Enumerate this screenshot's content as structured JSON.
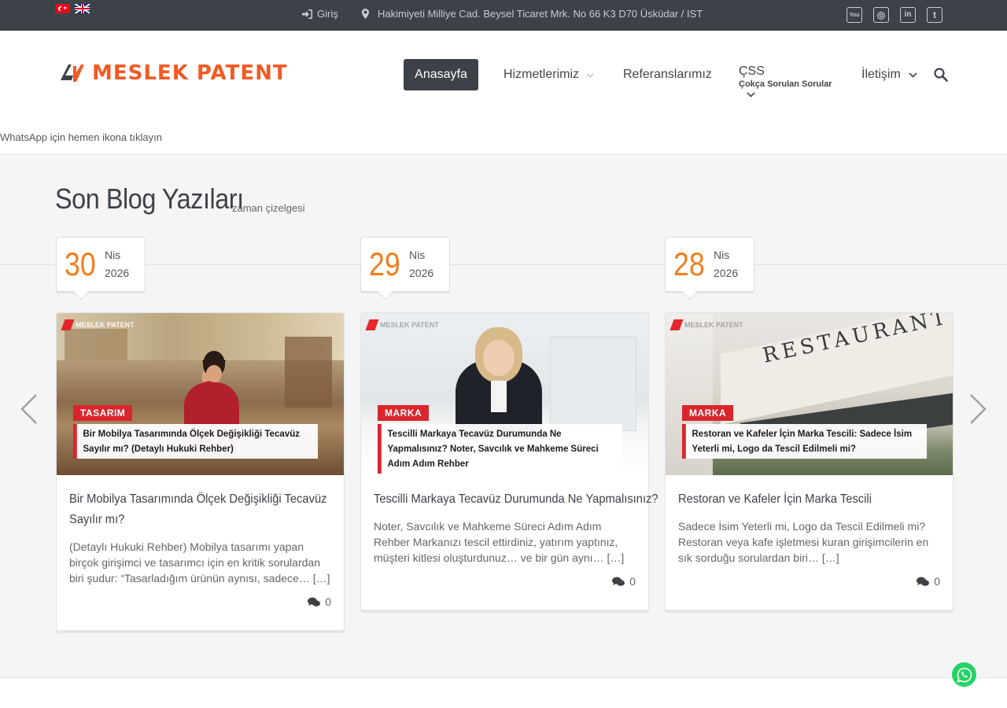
{
  "topbar": {
    "login_label": "Giriş",
    "address": "Hakimiyeti Milliye Cad. Beysel Ticaret Mrk. No 66 K3 D70 Üsküdar / IST",
    "flags": [
      "tr-flag-icon",
      "en-flag-icon"
    ],
    "social_icons": [
      "youtube-icon",
      "instagram-icon",
      "linkedin-icon",
      "twitter-icon"
    ],
    "social_glyphs": {
      "youtube": "You",
      "instagram": "◎",
      "linkedin": "in",
      "twitter": "t"
    }
  },
  "header": {
    "logo_text": "MESLEK PATENT",
    "nav": {
      "home": "Anasayfa",
      "services": "Hizmetlerimiz",
      "references": "Referanslarımız",
      "faq_title": "ÇSS",
      "faq_subtitle": "Çokça Sorulan Sorular",
      "contact": "İletişim"
    }
  },
  "whatsapp_note": "WhatsApp için hemen ikona tıklayın",
  "blog": {
    "title": "Son Blog Yazıları",
    "subtitle": "zaman çizelgesi",
    "posts": [
      {
        "day": "30",
        "month": "Nis",
        "year": "2026",
        "watermark": "MESLEK PATENT",
        "category": "TASARIM",
        "banner": "Bir Mobilya Tasarımında Ölçek Değişikliği Tecavüz Sayılır mı? (Detaylı Hukuki Rehber)",
        "title": "Bir Mobilya Tasarımında Ölçek Değişikliği Tecavüz Sayılır mı?",
        "excerpt": " (Detaylı Hukuki Rehber) Mobilya tasarımı yapan birçok girişimci ve tasarımcı için en kritik sorulardan biri şudur: “Tasarladığım ürünün aynısı, sadece… […]",
        "comments": "0"
      },
      {
        "day": "29",
        "month": "Nis",
        "year": "2026",
        "watermark": "MESLEK PATENT",
        "category": "MARKA",
        "banner": "Tescilli Markaya Tecavüz Durumunda Ne Yapmalısınız? Noter, Savcılık ve Mahkeme Süreci Adım Adım Rehber",
        "title": "Tescilli Markaya Tecavüz Durumunda Ne Yapmalısınız?",
        "excerpt": "Noter, Savcılık ve Mahkeme Süreci Adım Adım Rehber Markanızı tescil ettirdiniz, yatırım yaptınız, müşteri kitlesi oluşturdunuz… ve bir gün aynı… […]",
        "comments": "0"
      },
      {
        "day": "28",
        "month": "Nis",
        "year": "2026",
        "watermark": "MESLEK PATENT",
        "category": "MARKA",
        "banner": "Restoran ve Kafeler İçin Marka Tescili: Sadece İsim Yeterli mi, Logo da Tescil Edilmeli mi?",
        "image_text": "RESTAURANT",
        "title": "Restoran ve Kafeler İçin Marka Tescili",
        "excerpt": "Sadece İsim Yeterli mi, Logo da Tescil Edilmeli mi? Restoran veya kafe işletmesi kuran girişimcilerin en sık sorduğu sorulardan biri… […]",
        "comments": "0"
      }
    ]
  },
  "colors": {
    "topbar_bg": "#3d4148",
    "accent_orange": "#f07e1d",
    "category_red": "#d9262c",
    "whatsapp_green": "#25d366"
  }
}
